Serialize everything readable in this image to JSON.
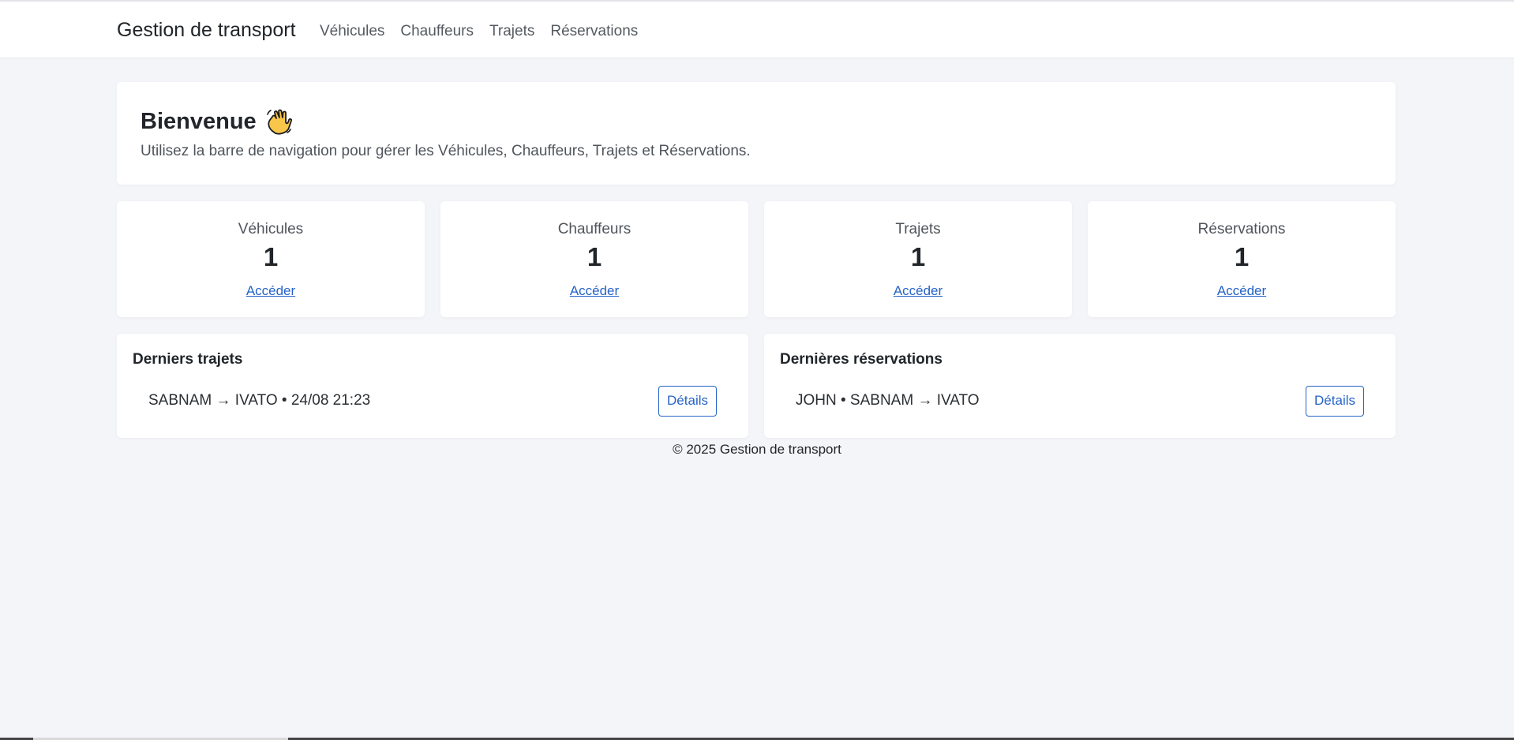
{
  "navbar": {
    "brand": "Gestion de transport",
    "links": [
      "Véhicules",
      "Chauffeurs",
      "Trajets",
      "Réservations"
    ]
  },
  "welcome": {
    "title": "Bienvenue",
    "icon": "waving-hand-icon",
    "subtitle": "Utilisez la barre de navigation pour gérer les Véhicules, Chauffeurs, Trajets et Réservations."
  },
  "stats": [
    {
      "label": "Véhicules",
      "value": "1",
      "link": "Accéder"
    },
    {
      "label": "Chauffeurs",
      "value": "1",
      "link": "Accéder"
    },
    {
      "label": "Trajets",
      "value": "1",
      "link": "Accéder"
    },
    {
      "label": "Réservations",
      "value": "1",
      "link": "Accéder"
    }
  ],
  "recent_trips": {
    "title": "Derniers trajets",
    "items": [
      {
        "text": "SABNAM → IVATO • 24/08 21:23",
        "button": "Détails"
      }
    ]
  },
  "recent_reservations": {
    "title": "Dernières réservations",
    "items": [
      {
        "text": "JOHN • SABNAM → IVATO",
        "button": "Détails"
      }
    ]
  },
  "footer": {
    "text": "© 2025 Gestion de transport"
  },
  "colors": {
    "accent": "#2563c7",
    "background": "#f4f5f9",
    "card": "#ffffff"
  }
}
